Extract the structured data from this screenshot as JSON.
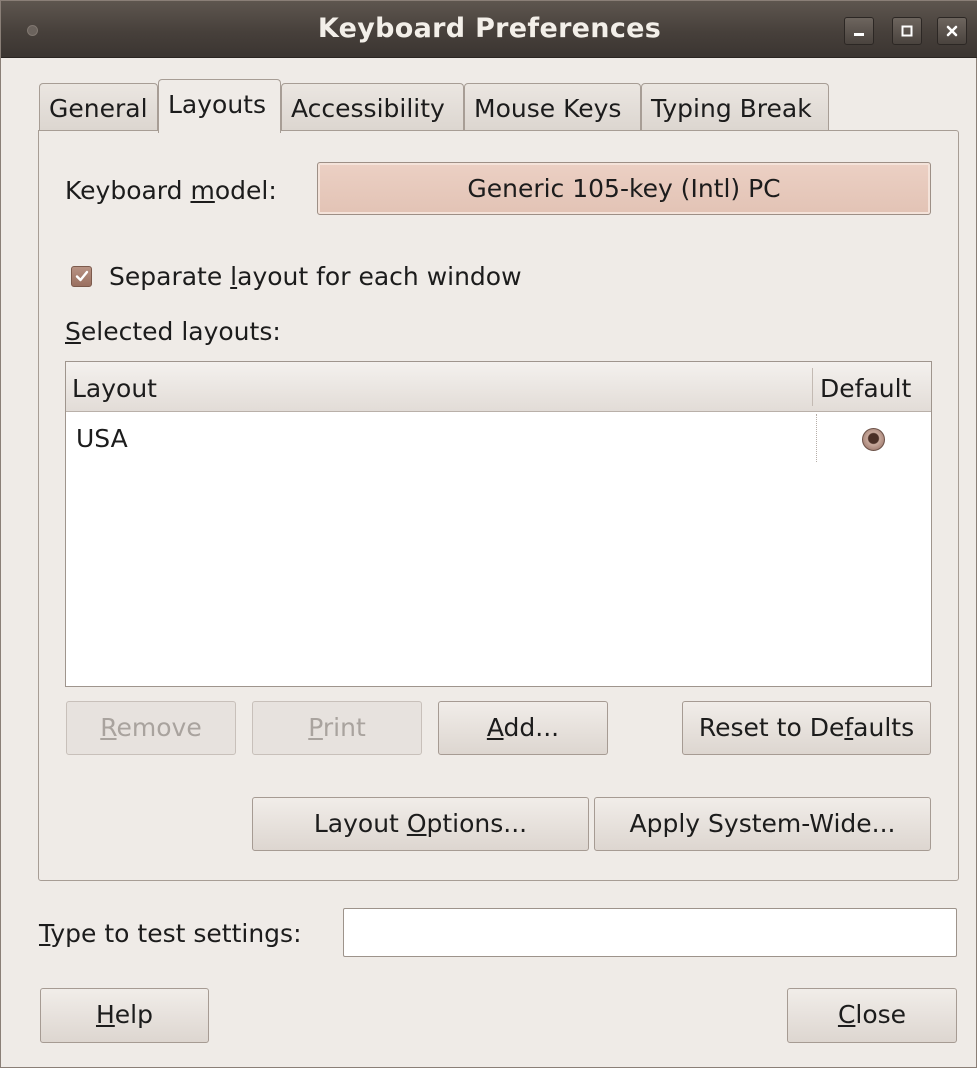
{
  "window": {
    "title": "Keyboard Preferences"
  },
  "tabs": [
    {
      "label": "General"
    },
    {
      "label": "Layouts"
    },
    {
      "label": "Accessibility"
    },
    {
      "label": "Mouse Keys"
    },
    {
      "label": "Typing Break"
    }
  ],
  "active_tab": "Layouts",
  "layouts_tab": {
    "keyboard_model": {
      "label_pre": "Keyboard ",
      "label_mnemonic": "m",
      "label_post": "odel:",
      "value": "Generic 105-key (Intl) PC"
    },
    "separate_layout": {
      "label_pre": "Separate ",
      "label_mnemonic": "l",
      "label_post": "ayout for each window",
      "checked": true
    },
    "selected_layouts": {
      "label_mnemonic": "S",
      "label_post": "elected layouts:",
      "columns": [
        "Layout",
        "Default"
      ],
      "rows": [
        {
          "layout": "USA",
          "default": true
        }
      ]
    },
    "buttons": {
      "remove": {
        "mnemonic": "R",
        "rest": "emove",
        "enabled": false
      },
      "print": {
        "mnemonic": "P",
        "rest": "rint",
        "enabled": false
      },
      "add": {
        "mnemonic": "A",
        "rest": "dd...",
        "enabled": true
      },
      "reset": {
        "pre": "Reset to De",
        "mnemonic": "f",
        "post": "aults",
        "enabled": true
      },
      "layout_options": {
        "pre": "Layout ",
        "mnemonic": "O",
        "post": "ptions...",
        "enabled": true
      },
      "apply_system_wide": {
        "label": "Apply System-Wide...",
        "enabled": true
      }
    }
  },
  "test_settings": {
    "label_mnemonic": "T",
    "label_post": "ype to test settings:",
    "value": ""
  },
  "footer": {
    "help": {
      "mnemonic": "H",
      "rest": "elp"
    },
    "close": {
      "mnemonic": "C",
      "rest": "lose"
    }
  },
  "colors": {
    "titlebar": "#47403b",
    "window_bg": "#efebe7",
    "accent": "#a9867a"
  }
}
